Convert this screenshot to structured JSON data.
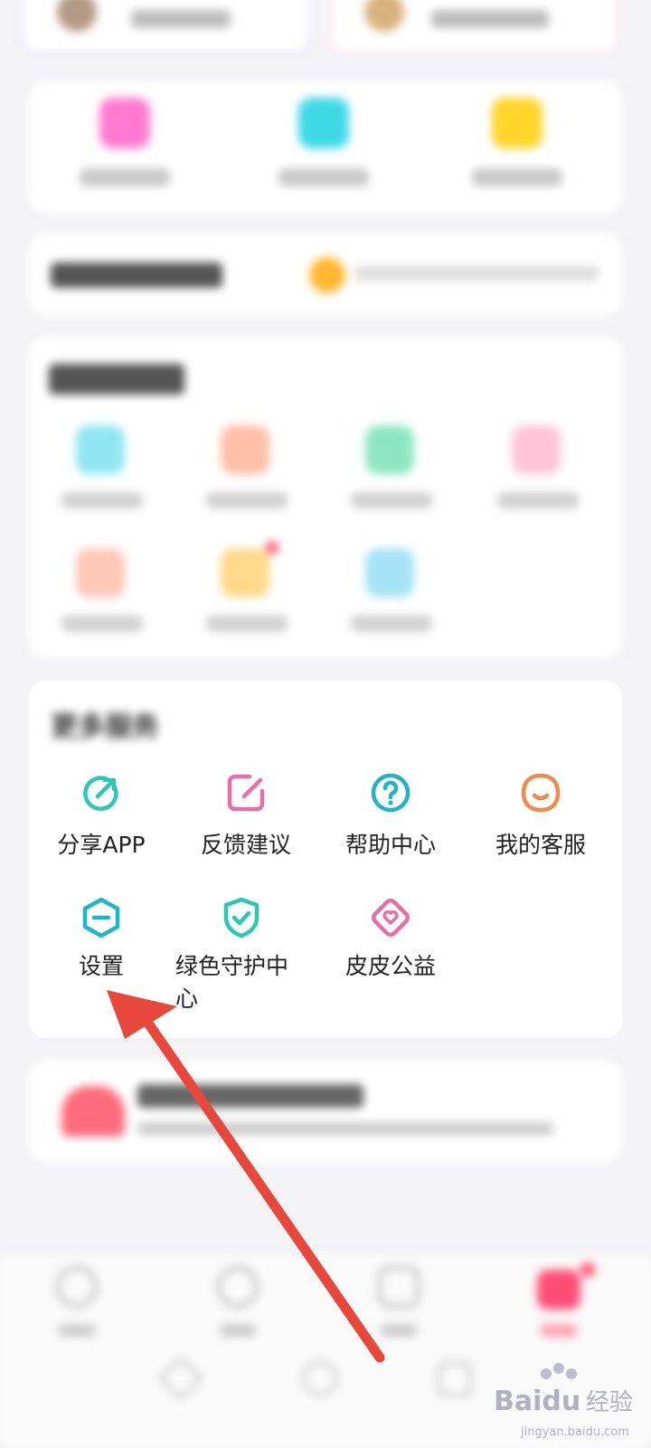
{
  "more_services": {
    "title": "更多服务",
    "items": [
      {
        "label": "分享APP",
        "icon": "share-icon",
        "color": "#2ec6b4"
      },
      {
        "label": "反馈建议",
        "icon": "feedback-edit-icon",
        "color": "#e86fa6"
      },
      {
        "label": "帮助中心",
        "icon": "help-question-icon",
        "color": "#22b3c7"
      },
      {
        "label": "我的客服",
        "icon": "customer-service-smile-icon",
        "color": "#f08a4b"
      },
      {
        "label": "设置",
        "icon": "settings-hexagon-icon",
        "color": "#1fb6c9"
      },
      {
        "label": "绿色守护中心",
        "label_line1": "绿色守护中",
        "label_line2": "心",
        "icon": "shield-check-icon",
        "color": "#2ec6b4"
      },
      {
        "label": "皮皮公益",
        "icon": "charity-heart-icon",
        "color": "#e86fa6"
      }
    ]
  },
  "annotation": {
    "color": "#e8483c"
  },
  "watermark": {
    "brand": "Baidu",
    "suffix": "经验",
    "url": "jingyan.baidu.com"
  }
}
